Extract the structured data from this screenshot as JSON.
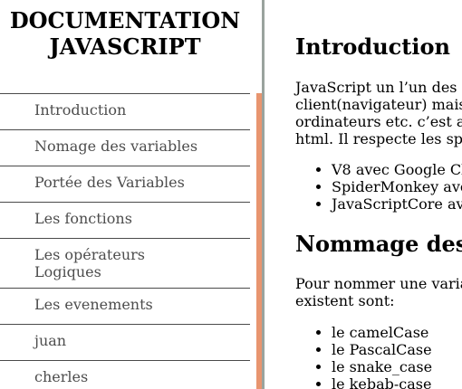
{
  "sidebar": {
    "title_line1": "DOCUMENTATION",
    "title_line2": "JAVASCRIPT",
    "items": [
      {
        "label": "Introduction"
      },
      {
        "label": "Nomage des variables"
      },
      {
        "label": "Portée des Variables"
      },
      {
        "label": "Les fonctions"
      },
      {
        "label": "Les opérateurs\nLogiques"
      },
      {
        "label": "Les evenements"
      },
      {
        "label": "juan"
      },
      {
        "label": "cherles"
      }
    ]
  },
  "main": {
    "intro": {
      "heading": "Introduction",
      "lines": [
        "JavaScript un l’un des",
        "client(navigateur) mais",
        "ordinateurs etc. c’est a",
        "html. Il respecte les sp"
      ],
      "engines": [
        "V8 avec Google Cl",
        "SpiderMonkey ave",
        "JavaScriptCore av"
      ]
    },
    "naming": {
      "heading": "Nommage des",
      "lines": [
        "Pour nommer une varia",
        "existent sont:"
      ],
      "cases": [
        "le camelCase",
        "le PascalCase",
        "le snake_case",
        "le kebab-case"
      ]
    }
  },
  "colors": {
    "scroll_accent": "#e8956f",
    "divider": "#9aa39e",
    "nav_text": "#4d4d4d",
    "nav_border": "#4a4a4a"
  }
}
